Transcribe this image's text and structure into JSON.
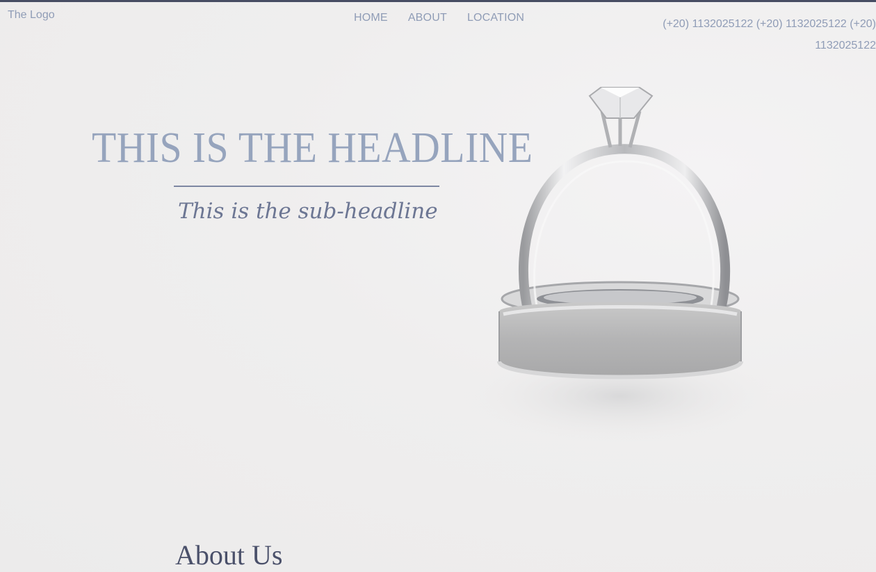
{
  "header": {
    "logo": "The Logo",
    "nav": [
      {
        "label": "HOME"
      },
      {
        "label": "ABOUT"
      },
      {
        "label": "LOCATION"
      }
    ],
    "phones_line1": "(+20) 1132025122 (+20) 1132025122 (+20)",
    "phones_line2": "1132025122"
  },
  "hero": {
    "headline": "THIS IS THE HEADLINE",
    "subheadline": "This is the sub-headline"
  },
  "about": {
    "title": "About Us"
  },
  "colors": {
    "accent": "#8f9cb6",
    "headline": "#96a4bd",
    "subheadline": "#6c7693",
    "topbar": "#474d63",
    "background": "#eeeded",
    "about_title": "#4a506a"
  }
}
